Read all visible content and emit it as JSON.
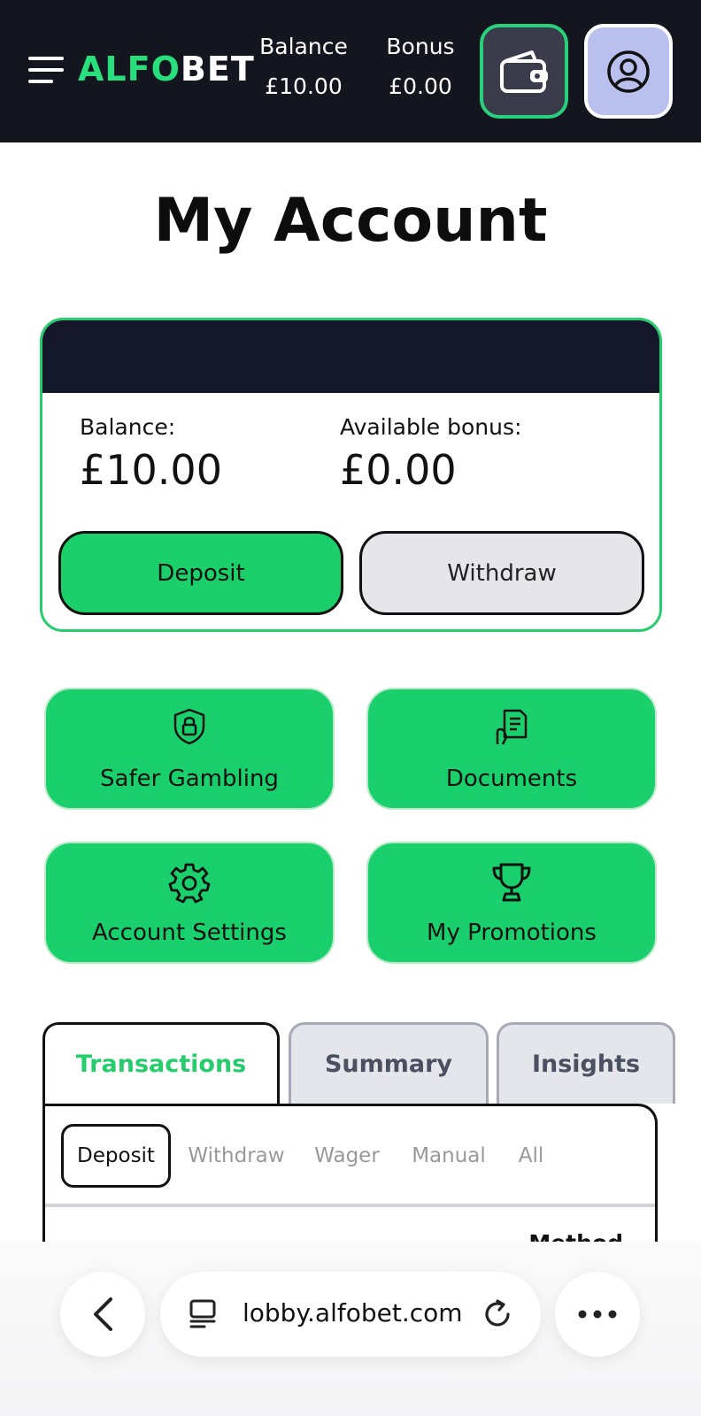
{
  "header": {
    "logo": {
      "part1": "ALF",
      "part2": "O",
      "part3": "BET"
    },
    "balance_label": "Balance",
    "balance_value": "£10.00",
    "bonus_label": "Bonus",
    "bonus_value": "£0.00",
    "colors": {
      "background": "#14161f",
      "accent": "#27e07c"
    }
  },
  "page": {
    "title": "My Account"
  },
  "account_card": {
    "balance_label": "Balance:",
    "balance_value": "£10.00",
    "bonus_label": "Available bonus:",
    "bonus_value": "£0.00",
    "deposit_label": "Deposit",
    "withdraw_label": "Withdraw"
  },
  "tiles": [
    {
      "label": "Safer Gambling",
      "icon": "shield-lock-icon"
    },
    {
      "label": "Documents",
      "icon": "document-hand-icon"
    },
    {
      "label": "Account Settings",
      "icon": "gear-icon"
    },
    {
      "label": "My Promotions",
      "icon": "trophy-icon"
    }
  ],
  "tabs": [
    {
      "label": "Transactions",
      "active": true
    },
    {
      "label": "Summary",
      "active": false
    },
    {
      "label": "Insights",
      "active": false
    }
  ],
  "filters": [
    {
      "label": "Deposit",
      "active": true
    },
    {
      "label": "Withdraw",
      "active": false
    },
    {
      "label": "Wager",
      "active": false
    },
    {
      "label": "Manual",
      "active": false
    },
    {
      "label": "All",
      "active": false
    }
  ],
  "table": {
    "column_method": "Method"
  },
  "browser": {
    "url": "lobby.alfobet.com"
  }
}
